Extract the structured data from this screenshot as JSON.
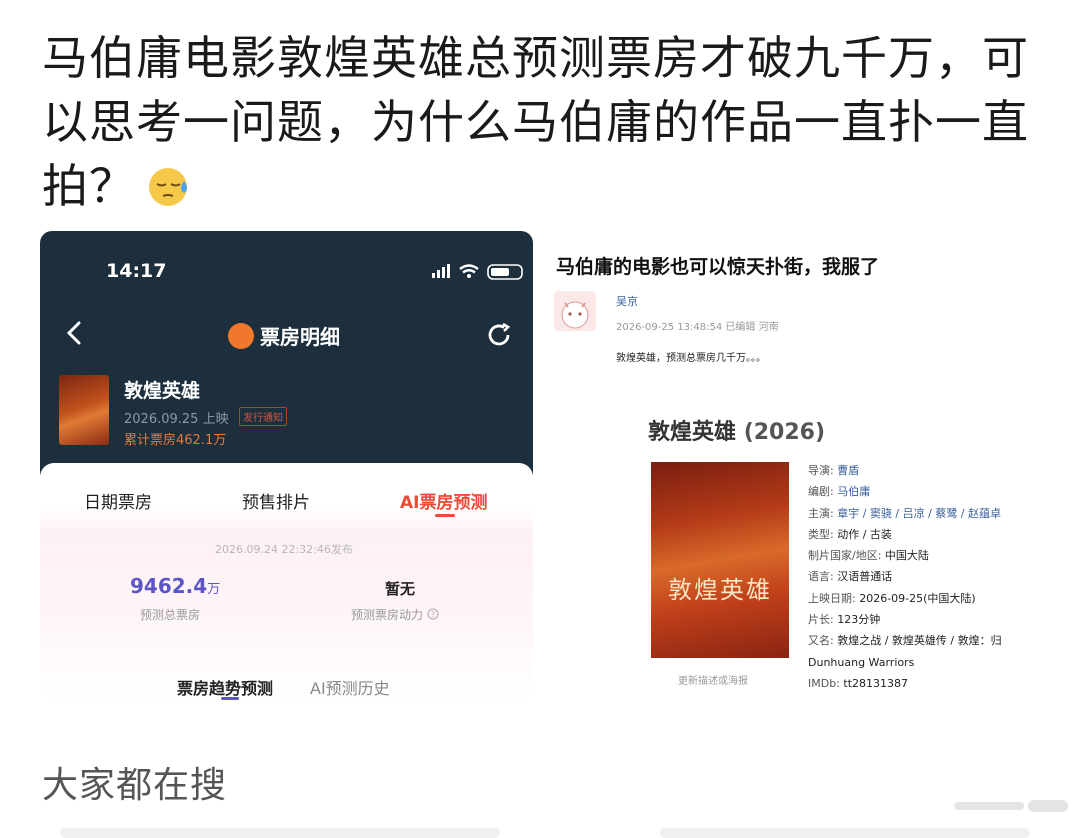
{
  "post": {
    "text": "马伯庸电影敦煌英雄总预测票房才破九千万，可以思考一问题，为什么马伯庸的作品一直扑一直拍？"
  },
  "left_screenshot": {
    "status_time": "14:17",
    "nav_title": "票房明细",
    "movie": {
      "title": "敦煌英雄",
      "date": "2026.09.25 上映",
      "badge": "发行通知",
      "box_total": "累计票房462.1万"
    },
    "tabs": [
      "日期票房",
      "预售排片",
      "AI票房预测"
    ],
    "active_tab": "AI票房预测",
    "published": "2026.09.24 22:32:46发布",
    "predict_value": "9462.4",
    "predict_unit": "万",
    "predict_label": "预测总票房",
    "no_data": "暂无",
    "power_label": "预测票房动力",
    "subtabs": [
      "票房趋势预测",
      "AI预测历史"
    ]
  },
  "right_screenshot": {
    "heading": "马伯庸的电影也可以惊天扑街，我服了",
    "user": "吴京",
    "meta": "2026-09-25 13:48:54 已编辑 河南",
    "body": "敦煌英雄，预测总票房几千万。。。",
    "movie_title": "敦煌英雄",
    "movie_year": "(2026)",
    "poster_title": "敦煌英雄",
    "poster_note": "更新描述或海报",
    "info": {
      "director_k": "导演:",
      "director_v": "曹盾",
      "writer_k": "编剧:",
      "writer_v": "马伯庸",
      "cast_k": "主演:",
      "cast_v": "章宇 / 窦骁 / 吕凉 / 蔡鹭 / 赵蕴卓",
      "genre_k": "类型:",
      "genre_v": "动作 / 古装",
      "country_k": "制片国家/地区:",
      "country_v": "中国大陆",
      "lang_k": "语言:",
      "lang_v": "汉语普通话",
      "release_k": "上映日期:",
      "release_v": "2026-09-25(中国大陆)",
      "length_k": "片长:",
      "length_v": "123分钟",
      "aka_k": "又名:",
      "aka_v": "敦煌之战 / 敦煌英雄传 / 敦煌：归",
      "aka_en": "Dunhuang Warriors",
      "imdb_k": "IMDb:",
      "imdb_v": "tt28131387"
    }
  },
  "search_heading": "大家都在搜"
}
